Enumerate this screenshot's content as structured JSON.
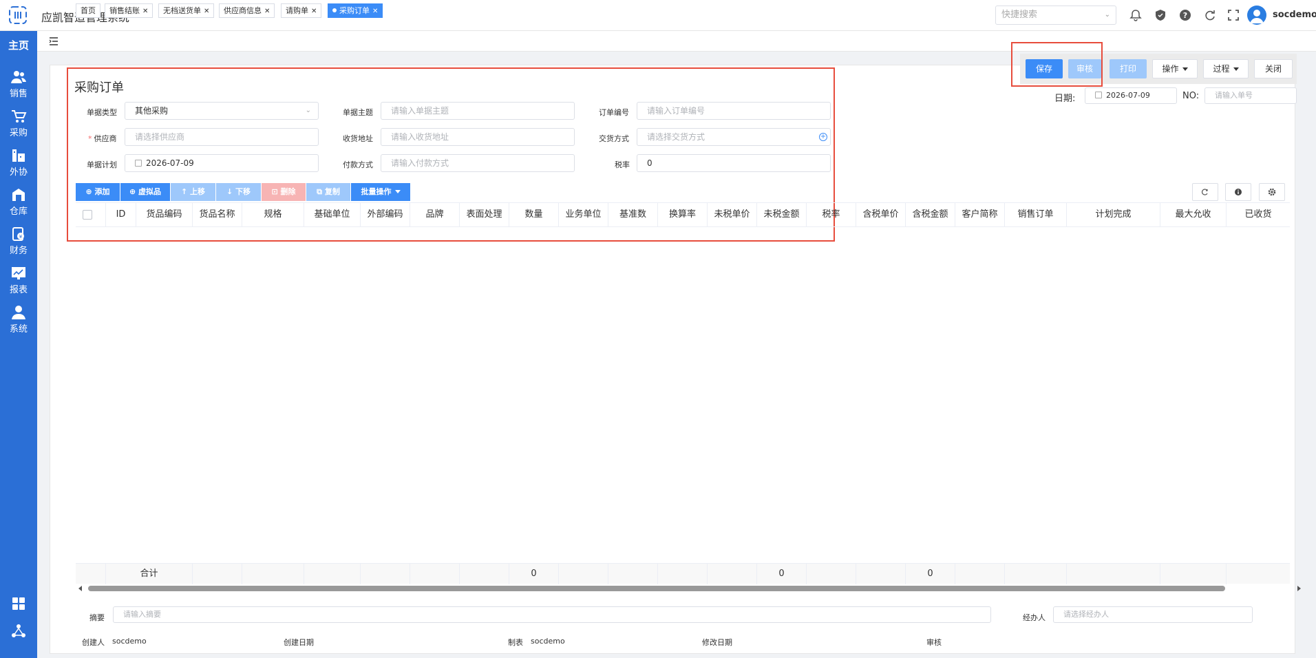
{
  "app": {
    "title": "应凯智造管理系统",
    "username": "socdemo"
  },
  "header": {
    "quick_search_placeholder": "快捷搜索"
  },
  "sidebar": {
    "home": "主页",
    "items": [
      {
        "label": "销售",
        "icon": "users-icon"
      },
      {
        "label": "采购",
        "icon": "cart-icon"
      },
      {
        "label": "外协",
        "icon": "factory-icon"
      },
      {
        "label": "仓库",
        "icon": "warehouse-icon"
      },
      {
        "label": "财务",
        "icon": "finance-icon"
      },
      {
        "label": "报表",
        "icon": "chart-icon"
      },
      {
        "label": "系统",
        "icon": "user-icon"
      }
    ]
  },
  "tabs": [
    {
      "label": "首页",
      "closable": false
    },
    {
      "label": "销售结账",
      "closable": true
    },
    {
      "label": "无档送货单",
      "closable": true
    },
    {
      "label": "供应商信息",
      "closable": true
    },
    {
      "label": "请购单",
      "closable": true
    },
    {
      "label": "采购订单",
      "closable": true,
      "active": true
    }
  ],
  "page": {
    "title": "采购订单"
  },
  "actions": {
    "save": "保存",
    "audit": "审核",
    "print": "打印",
    "operate": "操作",
    "process": "过程",
    "close": "关闭"
  },
  "meta": {
    "date_label": "日期:",
    "date_value": "2026-07-09",
    "no_label": "NO:",
    "no_placeholder": "请输入单号"
  },
  "form": {
    "doc_type": {
      "label": "单据类型",
      "value": "其他采购"
    },
    "doc_subject": {
      "label": "单据主题",
      "placeholder": "请输入单据主题"
    },
    "order_no": {
      "label": "订单编号",
      "placeholder": "请输入订单编号"
    },
    "supplier": {
      "label": "供应商",
      "placeholder": "请选择供应商"
    },
    "ship_address": {
      "label": "收货地址",
      "placeholder": "请输入收货地址"
    },
    "delivery_method": {
      "label": "交货方式",
      "placeholder": "请选择交货方式"
    },
    "doc_plan": {
      "label": "单据计划",
      "value": "2026-07-09"
    },
    "payment_method": {
      "label": "付款方式",
      "placeholder": "请输入付款方式"
    },
    "tax_rate": {
      "label": "税率",
      "value": "0"
    }
  },
  "toolbar": {
    "add": "添加",
    "virtual": "虚拟品",
    "move_up": "上移",
    "move_down": "下移",
    "delete": "删除",
    "copy": "复制",
    "batch": "批量操作"
  },
  "table": {
    "columns": [
      "ID",
      "货品编码",
      "货品名称",
      "规格",
      "基础单位",
      "外部编码",
      "品牌",
      "表面处理",
      "数量",
      "业务单位",
      "基准数",
      "换算率",
      "未税单价",
      "未税金额",
      "税率",
      "含税单价",
      "含税金额",
      "客户简称",
      "销售订单",
      "计划完成",
      "最大允收",
      "已收货"
    ],
    "footer": {
      "label": "合计",
      "qty": "0",
      "untaxed_amount": "0",
      "taxed_amount": "0"
    }
  },
  "bottom": {
    "summary_label": "摘要",
    "summary_placeholder": "请输入摘要",
    "handler_label": "经办人",
    "handler_placeholder": "请选择经办人",
    "creator_label": "创建人",
    "creator_value": "socdemo",
    "created_date_label": "创建日期",
    "maker_label": "制表",
    "maker_value": "socdemo",
    "modified_date_label": "修改日期",
    "audit_label": "审核"
  },
  "colors": {
    "primary": "#3b8cf7",
    "sidebar": "#2b6fd6",
    "highlight": "#e74c3c"
  }
}
